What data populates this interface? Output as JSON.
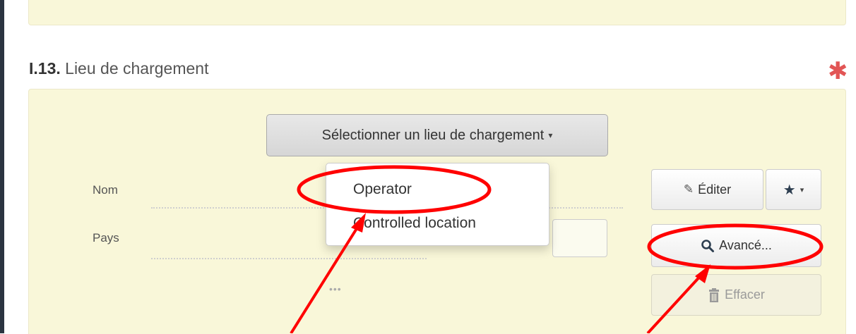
{
  "section": {
    "number": "I.13.",
    "title": "Lieu de chargement",
    "required_mark": "✱"
  },
  "selector": {
    "label": "Sélectionner un lieu de chargement",
    "caret": "▾"
  },
  "fields": {
    "name_label": "Nom",
    "country_label": "Pays",
    "more": "•••"
  },
  "dropdown": {
    "items": [
      {
        "label": "Operator"
      },
      {
        "label": "Controlled location"
      }
    ]
  },
  "buttons": {
    "edit": {
      "icon": "✎",
      "label": "Éditer",
      "icon_name": "edit-icon"
    },
    "favorite": {
      "icon": "★",
      "caret": "▾",
      "icon_name": "star-icon"
    },
    "advanced": {
      "icon_name": "search-icon",
      "label": "Avancé..."
    },
    "clear": {
      "icon": "🗑",
      "label": "Effacer",
      "icon_name": "trash-icon",
      "disabled": true
    }
  },
  "colors": {
    "panel_bg": "#f9f7d9",
    "annotation_red": "#ff0000",
    "required_red": "#e25555"
  },
  "icons": [
    "edit-icon",
    "star-icon",
    "search-icon",
    "trash-icon",
    "chevron-down-icon",
    "asterisk-icon"
  ]
}
